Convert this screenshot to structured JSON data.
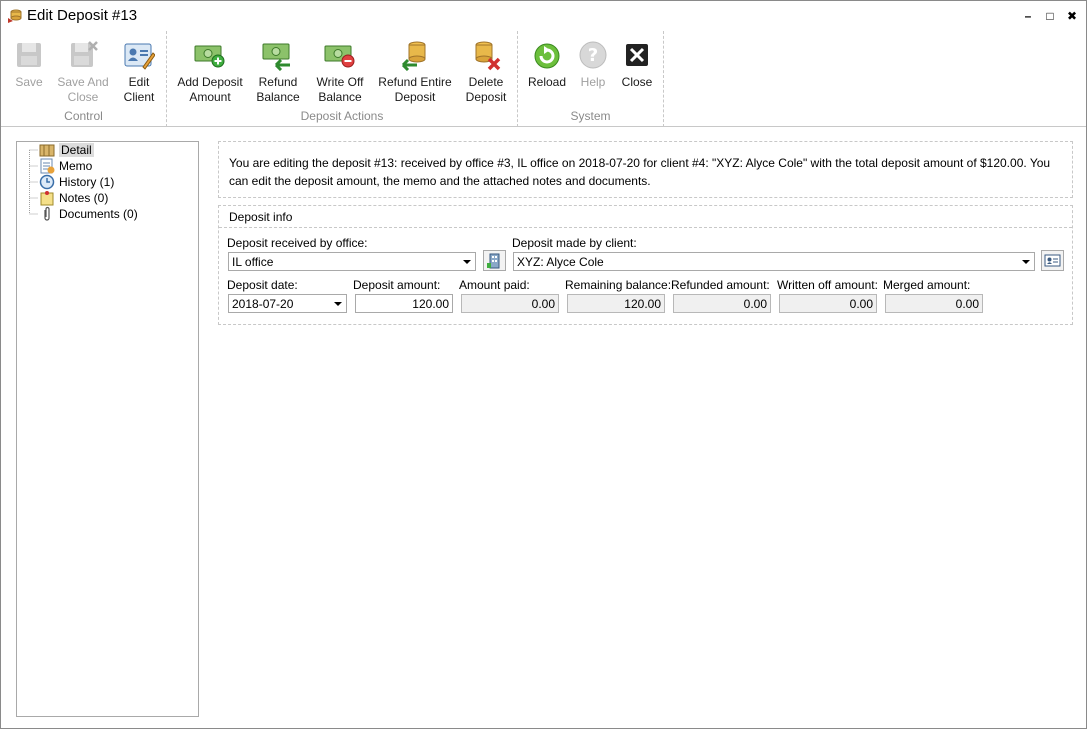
{
  "window": {
    "title": "Edit Deposit #13",
    "minimize_label": "–",
    "maximize_label": "□",
    "close_label": "✖"
  },
  "ribbon": {
    "groups": [
      {
        "label": "Control",
        "buttons": [
          {
            "label_line1": "Save",
            "label_line2": "",
            "icon": "save-icon",
            "enabled": false
          },
          {
            "label_line1": "Save And",
            "label_line2": "Close",
            "icon": "save-close-icon",
            "enabled": false
          },
          {
            "label_line1": "Edit",
            "label_line2": "Client",
            "icon": "edit-client-icon",
            "enabled": true
          }
        ]
      },
      {
        "label": "Deposit Actions",
        "buttons": [
          {
            "label_line1": "Add Deposit",
            "label_line2": "Amount",
            "icon": "add-money-icon",
            "enabled": true
          },
          {
            "label_line1": "Refund",
            "label_line2": "Balance",
            "icon": "refund-money-icon",
            "enabled": true
          },
          {
            "label_line1": "Write Off",
            "label_line2": "Balance",
            "icon": "write-off-money-icon",
            "enabled": true
          },
          {
            "label_line1": "Refund Entire",
            "label_line2": "Deposit",
            "icon": "refund-coins-icon",
            "enabled": true
          },
          {
            "label_line1": "Delete",
            "label_line2": "Deposit",
            "icon": "delete-coins-icon",
            "enabled": true
          }
        ]
      },
      {
        "label": "System",
        "buttons": [
          {
            "label_line1": "Reload",
            "label_line2": "",
            "icon": "reload-icon",
            "enabled": true
          },
          {
            "label_line1": "Help",
            "label_line2": "",
            "icon": "help-icon",
            "enabled": false
          },
          {
            "label_line1": "Close",
            "label_line2": "",
            "icon": "close-icon",
            "enabled": true
          }
        ]
      }
    ]
  },
  "sidebar": {
    "items": [
      {
        "label": "Detail",
        "icon": "detail-icon",
        "selected": true
      },
      {
        "label": "Memo",
        "icon": "memo-icon",
        "selected": false
      },
      {
        "label": "History (1)",
        "icon": "history-icon",
        "selected": false
      },
      {
        "label": "Notes (0)",
        "icon": "notes-icon",
        "selected": false
      },
      {
        "label": "Documents (0)",
        "icon": "paperclip-icon",
        "selected": false
      }
    ]
  },
  "info": {
    "text": "You are editing the deposit #13: received by office #3, IL office on 2018-07-20 for client #4: \"XYZ: Alyce Cole\" with the total deposit amount of $120.00. You can edit the deposit amount, the memo and the attached notes and documents."
  },
  "deposit": {
    "section_title": "Deposit info",
    "office_label": "Deposit received by office:",
    "office_value": "IL office",
    "client_label": "Deposit made by client:",
    "client_value": "XYZ: Alyce Cole",
    "date_label": "Deposit date:",
    "date_value": "2018-07-20",
    "amount_label": "Deposit amount:",
    "amount_value": "120.00",
    "paid_label": "Amount paid:",
    "paid_value": "0.00",
    "remaining_label": "Remaining balance:",
    "remaining_value": "120.00",
    "refunded_label": "Refunded amount:",
    "refunded_value": "0.00",
    "written_off_label": "Written off amount:",
    "written_off_value": "0.00",
    "merged_label": "Merged amount:",
    "merged_value": "0.00"
  }
}
